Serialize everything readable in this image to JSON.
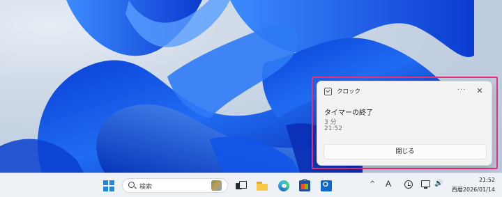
{
  "notification": {
    "app_name": "クロック",
    "more_label": "···",
    "close_label": "✕",
    "title": "タイマーの終了",
    "duration": "3 分",
    "time": "21:52",
    "dismiss_label": "閉じる"
  },
  "taskbar": {
    "search_placeholder": "検索",
    "tray": {
      "chevron": "^",
      "ime": "A",
      "volume": "🔊",
      "time": "21:52",
      "date": "西暦2026/01/14"
    }
  },
  "colors": {
    "highlight": "#e8317a",
    "start": "#1f87e5"
  }
}
